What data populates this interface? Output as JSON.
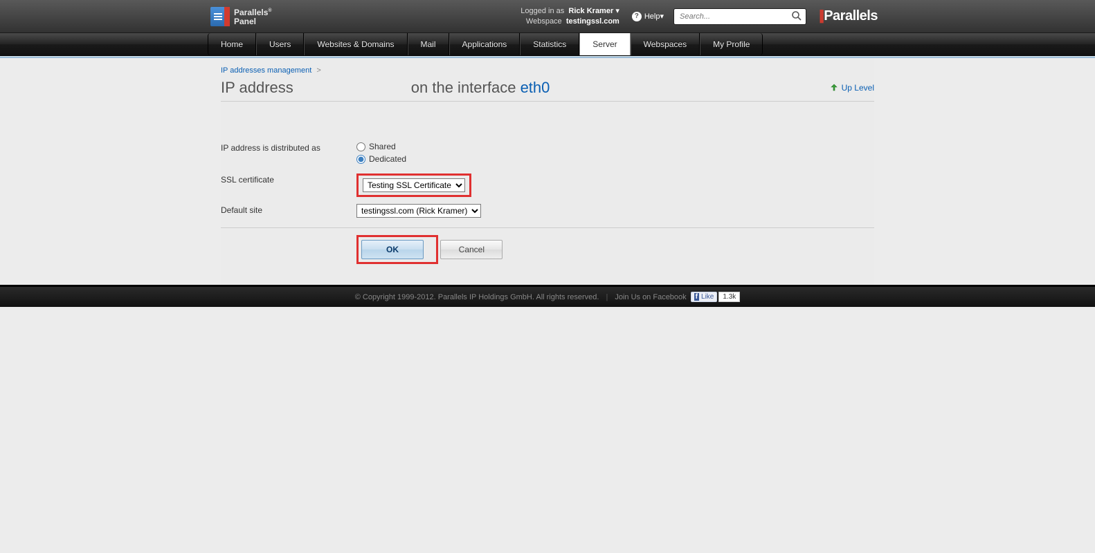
{
  "header": {
    "logo_line1": "Parallels",
    "logo_line2": "Panel",
    "logged_in_as_label": "Logged in as",
    "user_name": "Rick Kramer",
    "webspace_label": "Webspace",
    "webspace_value": "testingssl.com",
    "help_label": "Help",
    "search_placeholder": "Search...",
    "brand_right": "Parallels"
  },
  "nav": {
    "items": [
      "Home",
      "Users",
      "Websites & Domains",
      "Mail",
      "Applications",
      "Statistics",
      "Server",
      "Webspaces",
      "My Profile"
    ],
    "active_index": 6
  },
  "breadcrumb": {
    "link_text": "IP addresses management",
    "sep": ">"
  },
  "title": {
    "left": "IP address",
    "mid": "on the interface ",
    "iface": "eth0",
    "uplevel": "Up Level"
  },
  "form": {
    "dist_label": "IP address is distributed as",
    "dist_shared": "Shared",
    "dist_dedicated": "Dedicated",
    "dist_selected": "dedicated",
    "ssl_label": "SSL certificate",
    "ssl_selected": "Testing SSL Certificate",
    "defsite_label": "Default site",
    "defsite_selected": "testingssl.com (Rick Kramer)"
  },
  "buttons": {
    "ok": "OK",
    "cancel": "Cancel"
  },
  "footer": {
    "copyright": "© Copyright 1999-2012. Parallels IP Holdings GmbH. All rights reserved.",
    "facebook_text": "Join Us on Facebook",
    "like_label": "Like",
    "like_count": "1.3k"
  }
}
